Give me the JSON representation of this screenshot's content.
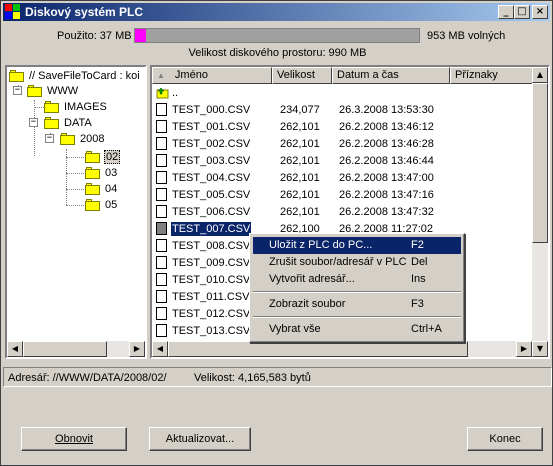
{
  "window": {
    "title": "Diskový systém PLC"
  },
  "usage": {
    "used_label": "Použito: 37 MB",
    "free_label": "953 MB volných",
    "capacity_label": "Velikost diskového prostoru: 990 MB",
    "used_fraction": 0.037,
    "fill_color": "#ff00ff"
  },
  "tree": {
    "root": "//  SaveFileToCard : koi",
    "nodes": [
      "WWW",
      "IMAGES",
      "DATA",
      "2008",
      "02",
      "03",
      "04",
      "05"
    ],
    "selected": "02"
  },
  "list": {
    "columns": [
      "Jméno",
      "Velikost",
      "Datum a čas",
      "Příznaky"
    ],
    "parent_label": "..",
    "rows": [
      {
        "name": "TEST_000.CSV",
        "size": "234,077",
        "date": "26.3.2008 13:53:30"
      },
      {
        "name": "TEST_001.CSV",
        "size": "262,101",
        "date": "26.2.2008 13:46:12"
      },
      {
        "name": "TEST_002.CSV",
        "size": "262,101",
        "date": "26.2.2008 13:46:28"
      },
      {
        "name": "TEST_003.CSV",
        "size": "262,101",
        "date": "26.2.2008 13:46:44"
      },
      {
        "name": "TEST_004.CSV",
        "size": "262,101",
        "date": "26.2.2008 13:47:00"
      },
      {
        "name": "TEST_005.CSV",
        "size": "262,101",
        "date": "26.2.2008 13:47:16"
      },
      {
        "name": "TEST_006.CSV",
        "size": "262,101",
        "date": "26.2.2008 13:47:32"
      },
      {
        "name": "TEST_007.CSV",
        "size": "262,100",
        "date": "26.2.2008 11:27:02"
      },
      {
        "name": "TEST_008.CSV",
        "size": "",
        "date": ""
      },
      {
        "name": "TEST_009.CSV",
        "size": "",
        "date": ""
      },
      {
        "name": "TEST_010.CSV",
        "size": "",
        "date": ""
      },
      {
        "name": "TEST_011.CSV",
        "size": "",
        "date": ""
      },
      {
        "name": "TEST_012.CSV",
        "size": "",
        "date": ""
      },
      {
        "name": "TEST_013.CSV",
        "size": "",
        "date": ""
      }
    ],
    "selected_row": 7
  },
  "context_menu": {
    "items": [
      {
        "label": "Uložit z PLC do PC...",
        "shortcut": "F2"
      },
      {
        "label": "Zrušit soubor/adresář v PLC",
        "shortcut": "Del"
      },
      {
        "label": "Vytvořit adresář...",
        "shortcut": "Ins"
      },
      {
        "label": "Zobrazit soubor",
        "shortcut": "F3"
      },
      {
        "label": "Vybrat vše",
        "shortcut": "Ctrl+A"
      }
    ]
  },
  "status": {
    "address": "Adresář: //WWW/DATA/2008/02/",
    "size": "Velikost: 4,165,583 bytů"
  },
  "buttons": {
    "refresh": "Obnovit",
    "update": "Aktualizovat...",
    "end": "Konec"
  },
  "icons": {
    "app": "plc-disk-icon",
    "folder": "folder-icon",
    "file": "file-icon",
    "up": "up-folder-icon"
  }
}
